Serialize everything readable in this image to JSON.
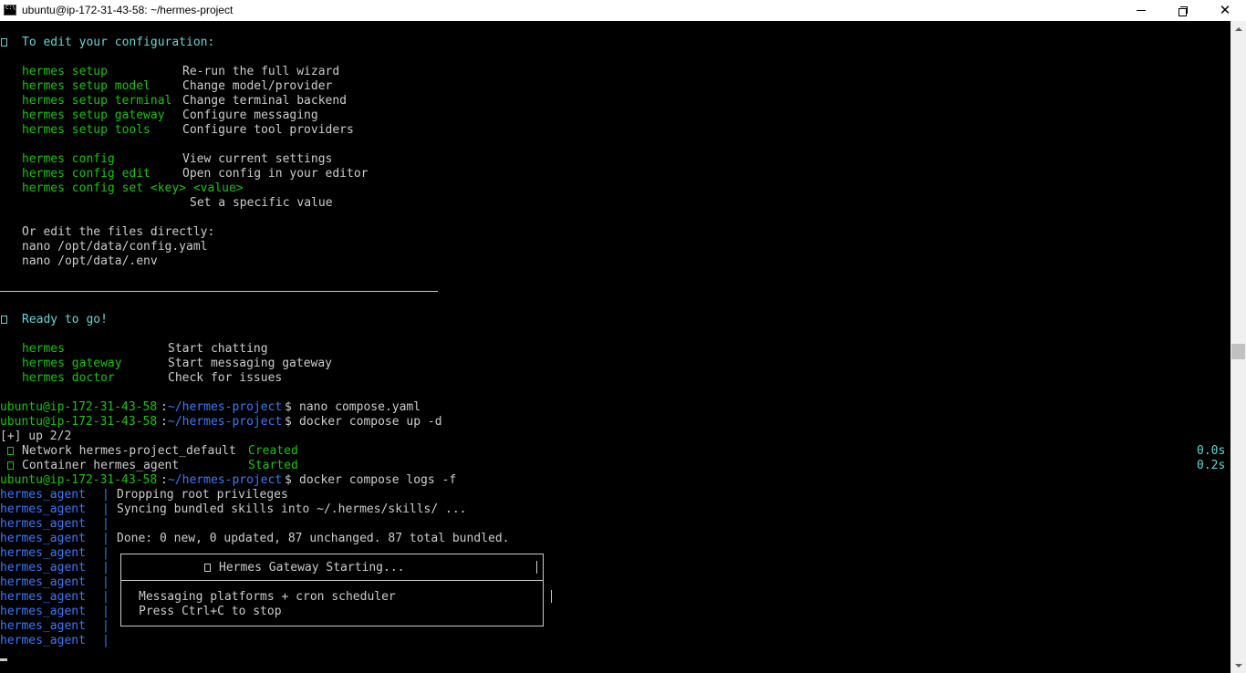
{
  "window": {
    "title": "ubuntu@ip-172-31-43-58: ~/hermes-project",
    "minimize_label": "",
    "close_label": "✕"
  },
  "colors": {
    "background": "#000000",
    "default_text": "#cccccc",
    "cyan": "#61d6d6",
    "green": "#16c60c",
    "blue_path": "#3b78ff"
  },
  "config_section": {
    "heading": "To edit your configuration:",
    "commands": [
      {
        "cmd": "hermes setup",
        "desc": "Re-run the full wizard"
      },
      {
        "cmd": "hermes setup model",
        "desc": "Change model/provider"
      },
      {
        "cmd": "hermes setup terminal",
        "desc": "Change terminal backend"
      },
      {
        "cmd": "hermes setup gateway",
        "desc": "Configure messaging"
      },
      {
        "cmd": "hermes setup tools",
        "desc": "Configure tool providers"
      },
      {
        "cmd": "hermes config",
        "desc": "View current settings"
      },
      {
        "cmd": "hermes config edit",
        "desc": "Open config in your editor"
      },
      {
        "cmd": "hermes config set <key> <value>",
        "desc": "Set a specific value"
      }
    ],
    "or_edit": "Or edit the files directly:",
    "files": [
      "nano /opt/data/config.yaml",
      "nano /opt/data/.env"
    ]
  },
  "ready_section": {
    "heading": "Ready to go!",
    "commands": [
      {
        "cmd": "hermes",
        "desc": "Start chatting"
      },
      {
        "cmd": "hermes gateway",
        "desc": "Start messaging gateway"
      },
      {
        "cmd": "hermes doctor",
        "desc": "Check for issues"
      }
    ]
  },
  "prompt": {
    "user_host": "ubuntu@ip-172-31-43-58",
    "colon": ":",
    "path": "~/hermes-project",
    "dollar": "$"
  },
  "shell_commands": [
    "nano compose.yaml",
    "docker compose up -d",
    "docker compose logs -f"
  ],
  "compose_up": {
    "summary": "[+] up 2/2",
    "items": [
      {
        "label": "Network hermes-project_default",
        "status": "Created",
        "time": "0.0s"
      },
      {
        "label": "Container hermes_agent",
        "status": "Started",
        "time": "0.2s"
      }
    ]
  },
  "logs": {
    "prefix": "hermes_agent",
    "pipe": "|",
    "lines": [
      "Dropping root privileges",
      "Syncing bundled skills into ~/.hermes/skills/ ...",
      "",
      "Done: 0 new, 0 updated, 87 unchanged. 87 total bundled.",
      "",
      "",
      "",
      "",
      "",
      "",
      ""
    ]
  },
  "gateway_box": {
    "title": "Hermes Gateway Starting...",
    "line1": "Messaging platforms + cron scheduler",
    "line2": "Press Ctrl+C to stop"
  }
}
